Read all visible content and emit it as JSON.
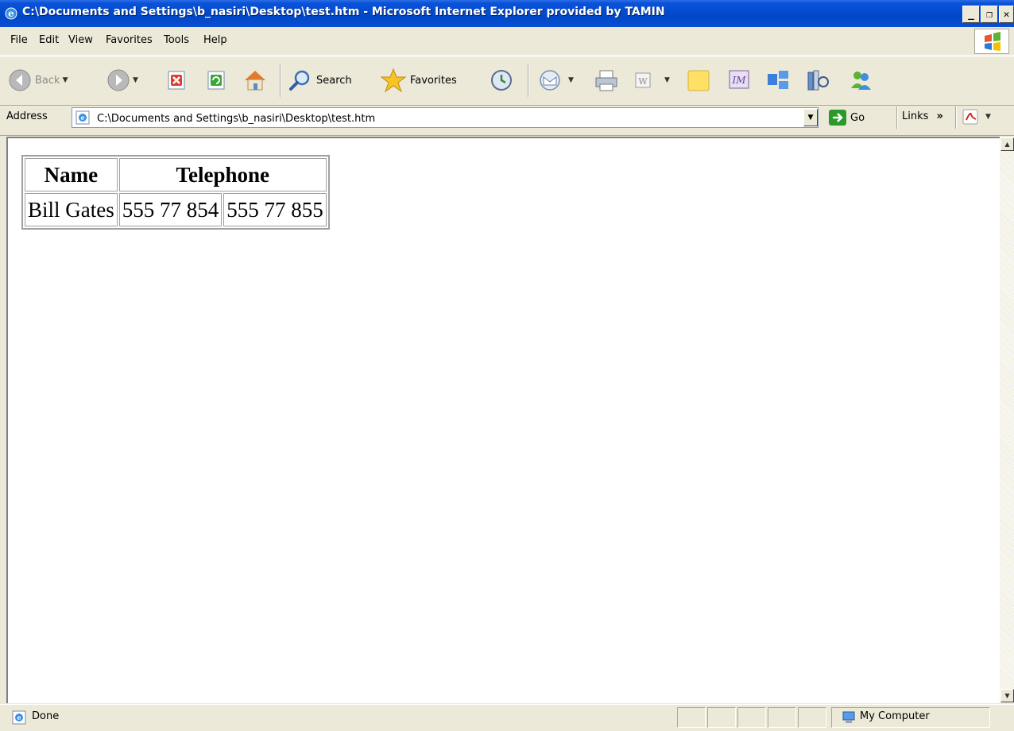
{
  "window": {
    "title": "C:\\Documents and Settings\\b_nasiri\\Desktop\\test.htm - Microsoft Internet Explorer provided by TAMIN",
    "minimize": "_",
    "maximize": "❐",
    "close": "✕"
  },
  "menu": {
    "items": [
      "File",
      "Edit",
      "View",
      "Favorites",
      "Tools",
      "Help"
    ]
  },
  "toolbar": {
    "back_label": "Back",
    "search_label": "Search",
    "favorites_label": "Favorites"
  },
  "address": {
    "label": "Address",
    "value": "C:\\Documents and Settings\\b_nasiri\\Desktop\\test.htm",
    "go_label": "Go",
    "links_label": "Links",
    "links_chevron": "»"
  },
  "table": {
    "headers": [
      "Name",
      "Telephone"
    ],
    "rows": [
      [
        "Bill Gates",
        "555 77 854",
        "555 77 855"
      ]
    ]
  },
  "status": {
    "text": "Done",
    "zone": "My Computer"
  },
  "colors": {
    "titlebar": "#0047c8",
    "chrome": "#ece9d8",
    "accent_green": "#2b9a2b"
  }
}
